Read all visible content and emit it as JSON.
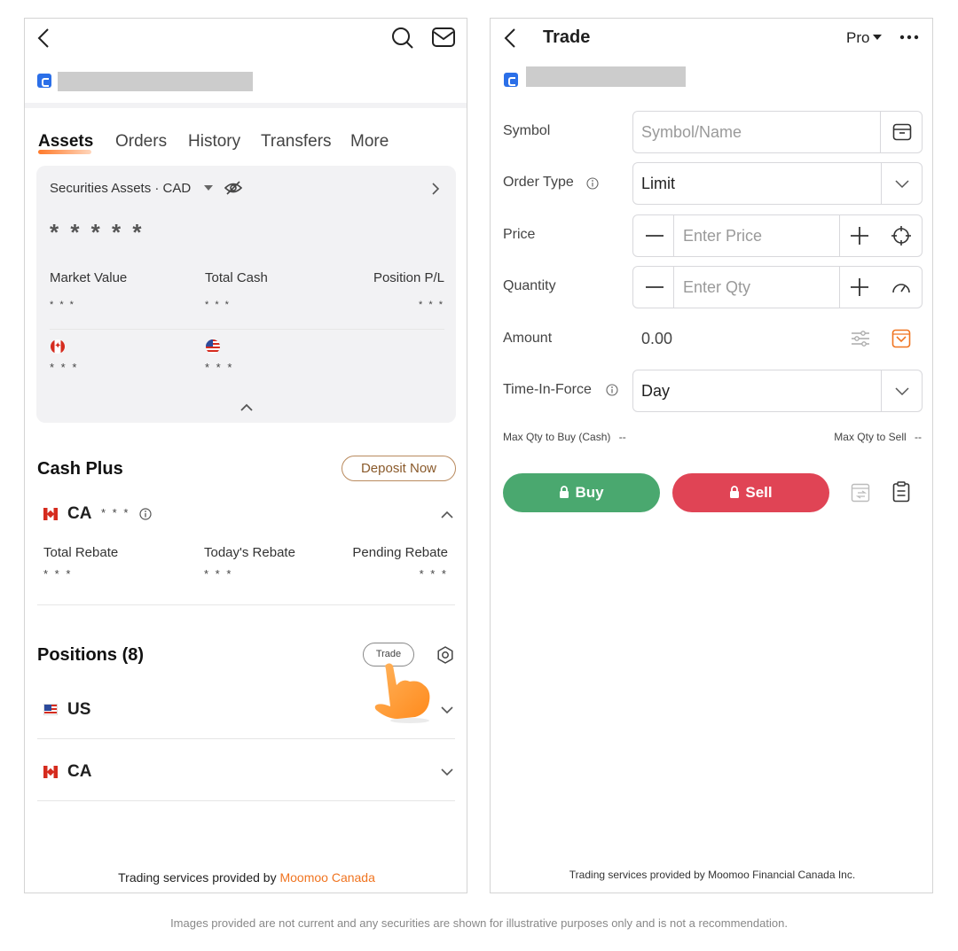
{
  "colors": {
    "brand_orange": "#f07420",
    "buy_green": "#4aa86f",
    "sell_red": "#e04455",
    "account_blue": "#2b6fe8",
    "card_bg": "#f2f2f4"
  },
  "left": {
    "icons": [
      "back-chevron-icon",
      "search-icon",
      "mail-icon"
    ],
    "tabs": [
      {
        "label": "Assets",
        "active": true
      },
      {
        "label": "Orders",
        "active": false
      },
      {
        "label": "History",
        "active": false
      },
      {
        "label": "Transfers",
        "active": false
      },
      {
        "label": "More",
        "active": false
      }
    ],
    "card": {
      "heading": "Securities Assets",
      "currency": "· CAD",
      "hidden_total": "* * * * *",
      "metrics": [
        {
          "label": "Market Value",
          "value": "* * *"
        },
        {
          "label": "Total Cash",
          "value": "* * *"
        },
        {
          "label": "Position P/L",
          "value": "* * *"
        }
      ],
      "currencies": [
        {
          "flag": "ca-flag-icon",
          "value": "* * *"
        },
        {
          "flag": "us-flag-icon",
          "value": "* * *"
        }
      ]
    },
    "cash_plus": {
      "title": "Cash Plus",
      "deposit_label": "Deposit Now",
      "account_label": "CA",
      "account_value": "* * *",
      "rebates": [
        {
          "label": "Total Rebate",
          "value": "* * *"
        },
        {
          "label": "Today's Rebate",
          "value": "* * *"
        },
        {
          "label": "Pending Rebate",
          "value": "* * *"
        }
      ]
    },
    "positions": {
      "title": "Positions (8)",
      "trade_label": "Trade",
      "markets": [
        {
          "label": "US",
          "flag": "us-flag-icon"
        },
        {
          "label": "CA",
          "flag": "ca-flag-icon"
        }
      ]
    },
    "footer": {
      "prefix": "Trading services provided by ",
      "brand": "Moomoo Canada"
    }
  },
  "right": {
    "title": "Trade",
    "mode_label": "Pro",
    "menu_icon": "more-dots-icon",
    "form": {
      "symbol_label": "Symbol",
      "symbol_placeholder": "Symbol/Name",
      "order_type_label": "Order Type",
      "order_type_value": "Limit",
      "price_label": "Price",
      "price_placeholder": "Enter Price",
      "quantity_label": "Quantity",
      "quantity_placeholder": "Enter Qty",
      "amount_label": "Amount",
      "amount_value": "0.00",
      "tif_label": "Time-In-Force",
      "tif_value": "Day"
    },
    "max_buy_label": "Max Qty to Buy (Cash)",
    "max_buy_value": "--",
    "max_sell_label": "Max Qty to Sell",
    "max_sell_value": "--",
    "buy_label": "Buy",
    "sell_label": "Sell",
    "footer": "Trading services provided by Moomoo Financial Canada Inc."
  },
  "disclaimer": "Images provided are not current and any securities are shown for illustrative purposes only and is not a recommendation."
}
